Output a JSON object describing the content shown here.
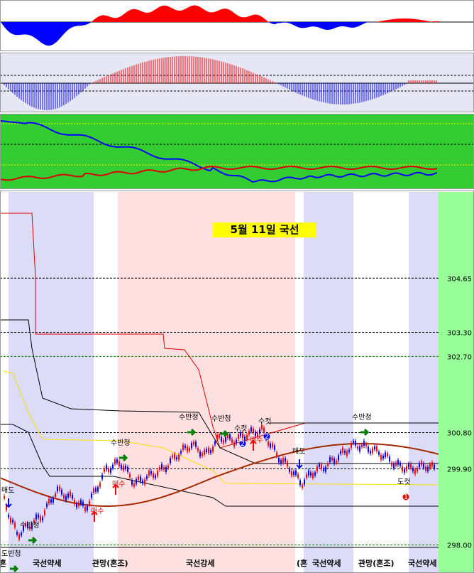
{
  "title": "5월 11일 국선",
  "colors": {
    "panel_border": "#000000",
    "strength_panel_bg": "#33cc33",
    "osc_panel_bg": "#e6e6f5",
    "band_blue": "#dcdcf8",
    "band_pink": "#ffe0e0",
    "band_green": "#99ff99",
    "up_color": "#ff0000",
    "down_color": "#0000ff",
    "arc_color": "#a52a00",
    "yellow_line": "#ffff00"
  },
  "chart_data": [
    {
      "type": "area",
      "panel": "top-oscillator",
      "series": [
        {
          "name": "",
          "positive_color": "#ff0000",
          "negative_color": "#0000ff"
        }
      ]
    },
    {
      "type": "bar",
      "panel": "histogram",
      "series": [
        {
          "name": "",
          "positive_color": "#ff0000",
          "negative_color": "#0000ff"
        }
      ]
    },
    {
      "type": "line",
      "panel": "strength",
      "series": [
        {
          "name": "",
          "color": "#0000ff"
        },
        {
          "name": "",
          "color": "#ff0000"
        }
      ]
    },
    {
      "type": "line",
      "panel": "price",
      "ylim": [
        297.3,
        306.8
      ],
      "y_ticks": [
        {
          "value": 304.65,
          "label": "304.65"
        },
        {
          "value": 303.3,
          "label": "303.30"
        },
        {
          "value": 302.7,
          "label": "302.70"
        },
        {
          "value": 300.8,
          "label": "300.80"
        },
        {
          "value": 299.9,
          "label": "299.90"
        },
        {
          "value": 298.0,
          "label": "298.00"
        }
      ],
      "grid": "dashed",
      "regimes": [
        {
          "label": "(혼",
          "shade": "blue"
        },
        {
          "label": "국선약세",
          "shade": "blue"
        },
        {
          "label": "관망(혼조)",
          "shade": "white"
        },
        {
          "label": "국선강세",
          "shade": "pink"
        },
        {
          "label": "(혼",
          "shade": "white"
        },
        {
          "label": "국선약세",
          "shade": "blue"
        },
        {
          "label": "관망(혼조)",
          "shade": "white"
        },
        {
          "label": "국선약세",
          "shade": "blue"
        }
      ],
      "signals": [
        {
          "label": "매도",
          "kind": "sell"
        },
        {
          "label": "수반청",
          "kind": "target"
        },
        {
          "label": "도반청",
          "kind": "target"
        },
        {
          "label": "매수",
          "kind": "buy"
        },
        {
          "label": "수반청",
          "kind": "target"
        },
        {
          "label": "매수",
          "kind": "buy"
        },
        {
          "label": "수반청",
          "kind": "target"
        },
        {
          "label": "수반청",
          "kind": "target"
        },
        {
          "label": "수컷",
          "kind": "cut",
          "badge": "2"
        },
        {
          "label": "매수",
          "kind": "buy"
        },
        {
          "label": "수컷",
          "kind": "cut",
          "badge": "2"
        },
        {
          "label": "매도",
          "kind": "sell"
        },
        {
          "label": "수반청",
          "kind": "target"
        },
        {
          "label": "도컷",
          "kind": "cut",
          "badge": "1"
        }
      ]
    }
  ]
}
